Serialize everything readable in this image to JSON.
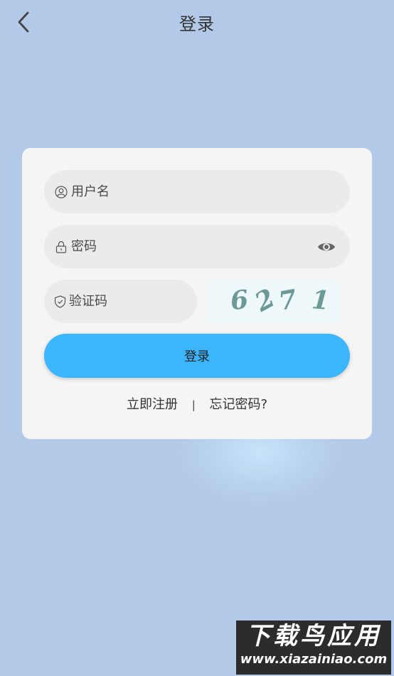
{
  "header": {
    "title": "登录"
  },
  "form": {
    "username_placeholder": "用户名",
    "password_placeholder": "密码",
    "captcha_placeholder": "验证码",
    "captcha_chars": [
      "6",
      "2",
      "7",
      "1"
    ],
    "login_label": "登录"
  },
  "links": {
    "register": "立即注册",
    "separator": "|",
    "forgot": "忘记密码?"
  },
  "watermark": {
    "title": "下载鸟应用",
    "url": "www.xiazainiao.com"
  },
  "colors": {
    "background": "#b3c9e8",
    "primary": "#3bb5fb",
    "card": "#f5f5f5",
    "field": "#ebebeb"
  }
}
